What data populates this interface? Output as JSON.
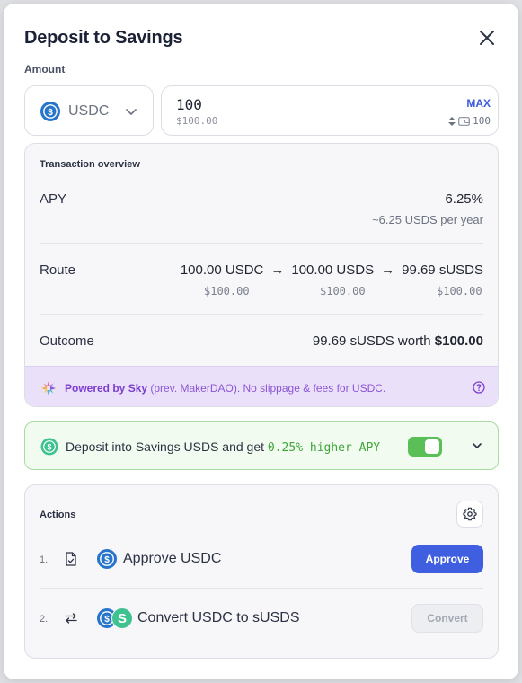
{
  "modal": {
    "title": "Deposit to Savings",
    "amount_label": "Amount"
  },
  "token_select": {
    "symbol": "USDC"
  },
  "amount_input": {
    "value": "100",
    "usd_value": "$100.00",
    "max_label": "MAX",
    "balance": "100"
  },
  "overview": {
    "heading": "Transaction overview",
    "apy_label": "APY",
    "apy_value": "6.25%",
    "apy_sub": "~6.25 USDS per year",
    "route_label": "Route",
    "route_steps": [
      {
        "amount": "100.00 USDC",
        "usd": "$100.00"
      },
      {
        "amount": "100.00 USDS",
        "usd": "$100.00"
      },
      {
        "amount": "99.69 sUSDS",
        "usd": "$100.00"
      }
    ],
    "route_arrow": "→",
    "outcome_label": "Outcome",
    "outcome_amount": "99.69 sUSDS worth",
    "outcome_usd": "$100.00",
    "powered_brand": "Powered by Sky",
    "powered_rest": " (prev. MakerDAO). No slippage & fees for USDC."
  },
  "promo": {
    "text_prefix": "Deposit into Savings USDS and get ",
    "text_highlight": "0.25% higher APY",
    "toggle_on": true
  },
  "actions": {
    "heading": "Actions",
    "steps": [
      {
        "num": "1.",
        "label": "Approve USDC",
        "button": "Approve"
      },
      {
        "num": "2.",
        "label": "Convert USDC to sUSDS",
        "button": "Convert"
      }
    ]
  },
  "colors": {
    "accent": "#3f5fe0",
    "usdc_blue": "#2775ca",
    "susds_green": "#3ec28f",
    "promo_green": "#3fa63a",
    "sky_purple": "#8c56d6"
  },
  "icons": [
    "close-icon",
    "usdc-icon",
    "chevron-down-icon",
    "sort-icon",
    "wallet-icon",
    "sky-logo-icon",
    "help-circle-icon",
    "susds-icon",
    "gear-icon",
    "document-check-icon",
    "swap-arrows-icon"
  ]
}
